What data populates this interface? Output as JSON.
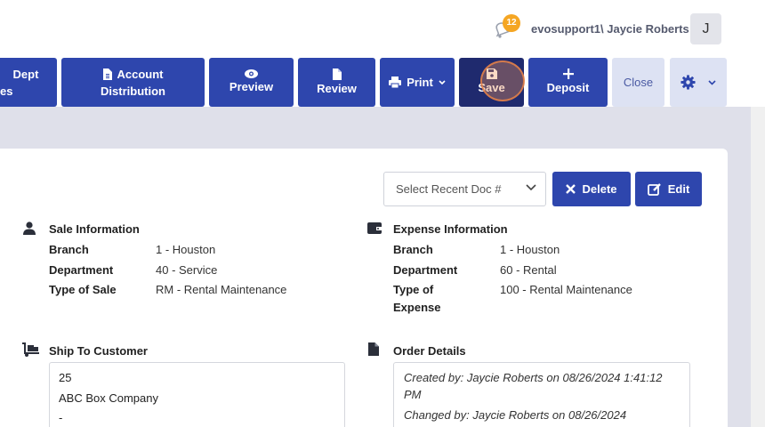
{
  "header": {
    "notification_count": "12",
    "user_display": "evosupport1\\ Jaycie Roberts",
    "avatar_initial": "J"
  },
  "toolbar": {
    "dept_line1": "Dept",
    "dept_line2": "es",
    "account_distribution_line1": "Account",
    "account_distribution_line2": "Distribution",
    "preview": "Preview",
    "review": "Review",
    "print": "Print",
    "save": "Save",
    "deposit": "Deposit",
    "close": "Close"
  },
  "doc_controls": {
    "recent_doc_placeholder": "Select Recent Doc #",
    "delete": "Delete",
    "edit": "Edit"
  },
  "sale_information": {
    "title": "Sale Information",
    "fields": [
      {
        "label": "Branch",
        "value": "1 - Houston"
      },
      {
        "label": "Department",
        "value": "40 - Service"
      },
      {
        "label": "Type of Sale",
        "value": "RM - Rental Maintenance"
      }
    ]
  },
  "expense_information": {
    "title": "Expense Information",
    "fields": [
      {
        "label": "Branch",
        "value": "1 - Houston"
      },
      {
        "label": "Department",
        "value": "60 - Rental"
      },
      {
        "label": "Type of",
        "label_line2": "Expense",
        "value": "100 - Rental Maintenance"
      }
    ]
  },
  "ship_to_customer": {
    "title": "Ship To Customer",
    "lines": [
      "25",
      "ABC Box Company",
      "-"
    ]
  },
  "order_details": {
    "title": "Order Details",
    "created_line1": "Created by: Jaycie Roberts on 08/26/2024 1:41:12",
    "created_line2": "PM",
    "changed_line": "Changed by: Jaycie Roberts on 08/26/2024"
  },
  "colors": {
    "primary": "#2e46ad",
    "primary_dark": "#1f2a6e",
    "light_button": "#dde2f3",
    "badge": "#f5a623",
    "background": "#dfe0ea"
  }
}
